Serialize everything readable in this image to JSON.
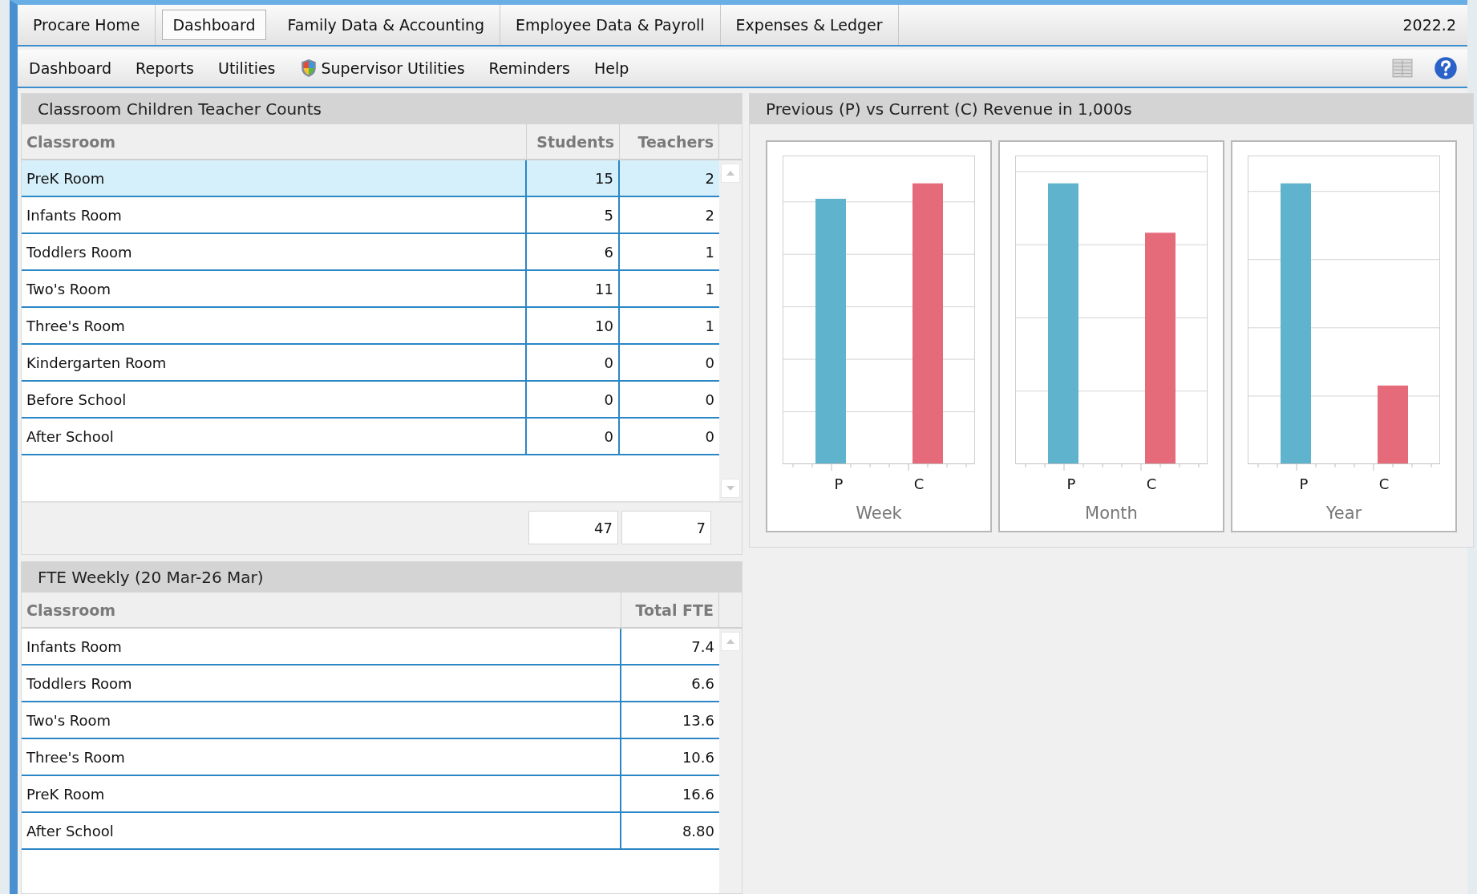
{
  "main_tabs": [
    {
      "label": "Procare Home",
      "selected": false
    },
    {
      "label": "Dashboard",
      "selected": true
    },
    {
      "label": "Family Data & Accounting",
      "selected": false
    },
    {
      "label": "Employee Data & Payroll",
      "selected": false
    },
    {
      "label": "Expenses & Ledger",
      "selected": false
    }
  ],
  "version": "2022.2",
  "menu": [
    {
      "label": "Dashboard",
      "kind": "text"
    },
    {
      "label": "Reports",
      "kind": "text"
    },
    {
      "label": "Utilities",
      "kind": "text"
    },
    {
      "label": "Supervisor Utilities",
      "kind": "shield"
    },
    {
      "label": "Reminders",
      "kind": "text"
    },
    {
      "label": "Help",
      "kind": "text"
    }
  ],
  "counts_panel": {
    "title": "Classroom Children Teacher Counts",
    "columns": [
      "Classroom",
      "Students",
      "Teachers"
    ],
    "rows": [
      {
        "cells": [
          "PreK Room",
          "15",
          "2"
        ],
        "selected": true
      },
      {
        "cells": [
          "Infants Room",
          "5",
          "2"
        ],
        "selected": false
      },
      {
        "cells": [
          "Toddlers Room",
          "6",
          "1"
        ],
        "selected": false
      },
      {
        "cells": [
          "Two's Room",
          "11",
          "1"
        ],
        "selected": false
      },
      {
        "cells": [
          "Three's Room",
          "10",
          "1"
        ],
        "selected": false
      },
      {
        "cells": [
          "Kindergarten Room",
          "0",
          "0"
        ],
        "selected": false
      },
      {
        "cells": [
          "Before School",
          "0",
          "0"
        ],
        "selected": false
      },
      {
        "cells": [
          "After School",
          "0",
          "0"
        ],
        "selected": false
      }
    ],
    "totals": [
      "47",
      "7"
    ]
  },
  "revenue_panel": {
    "title": "Previous (P) vs Current (C) Revenue in 1,000s",
    "charts": [
      {
        "title": "Week",
        "categories": [
          "P",
          "C"
        ]
      },
      {
        "title": "Month",
        "categories": [
          "P",
          "C"
        ]
      },
      {
        "title": "Year",
        "categories": [
          "P",
          "C"
        ]
      }
    ]
  },
  "fte_panel": {
    "title": "FTE Weekly (20 Mar-26 Mar)",
    "columns": [
      "Classroom",
      "Total FTE"
    ],
    "rows": [
      {
        "cells": [
          "Infants Room",
          "7.4"
        ],
        "selected": false
      },
      {
        "cells": [
          "Toddlers Room",
          "6.6"
        ],
        "selected": false
      },
      {
        "cells": [
          "Two's Room",
          "13.6"
        ],
        "selected": false
      },
      {
        "cells": [
          "Three's Room",
          "10.6"
        ],
        "selected": false
      },
      {
        "cells": [
          "PreK Room",
          "16.6"
        ],
        "selected": false
      },
      {
        "cells": [
          "After School",
          "8.80"
        ],
        "selected": false
      }
    ]
  }
}
